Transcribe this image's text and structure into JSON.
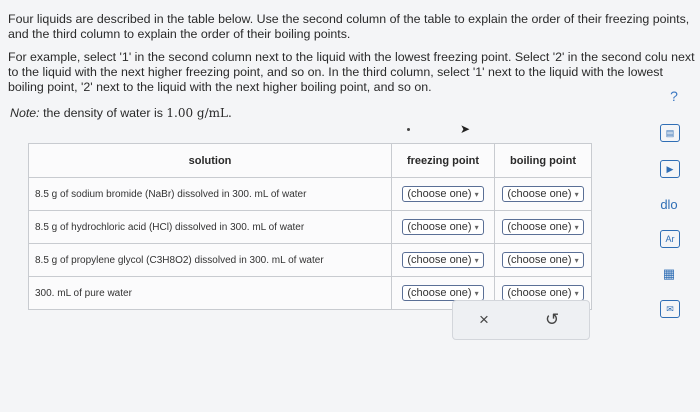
{
  "intro": {
    "p1": "Four liquids are described in the table below. Use the second column of the table to explain the order of their freezing points, and the third column to explain the order of their boiling points.",
    "p2": "For example, select '1' in the second column next to the liquid with the lowest freezing point. Select '2' in the second colu next to the liquid with the next higher freezing point, and so on. In the third column, select '1' next to the liquid with the lowest boiling point, '2' next to the liquid with the next higher boiling point, and so on."
  },
  "note": {
    "label": "Note:",
    "text": "the density of water is",
    "value": "1.00 g/mL."
  },
  "help": {
    "icon": "help-icon",
    "glyph": "?"
  },
  "table": {
    "headers": {
      "solution": "solution",
      "freezing": "freezing point",
      "boiling": "boiling point"
    },
    "rows": [
      {
        "solution": "8.5 g of sodium bromide (NaBr) dissolved in 300. mL of water",
        "freezing": "(choose one)",
        "boiling": "(choose one)"
      },
      {
        "solution": "8.5 g of hydrochloric acid (HCl) dissolved in 300. mL of water",
        "freezing": "(choose one)",
        "boiling": "(choose one)"
      },
      {
        "solution": "8.5 g of propylene glycol (C3H8O2) dissolved in 300. mL of water",
        "freezing": "(choose one)",
        "boiling": "(choose one)"
      },
      {
        "solution": "300. mL of pure water",
        "freezing": "(choose one)",
        "boiling": "(choose one)"
      }
    ]
  },
  "actions": {
    "clear": "×",
    "undo": "↺"
  },
  "tools": [
    "calculator-icon",
    "video-icon",
    "chart-icon",
    "periodic-table-icon",
    "data-table-icon",
    "mail-icon"
  ],
  "tool_glyphs": {
    "video": "▶",
    "chart": "dlo",
    "periodic": "Ar",
    "data": "▦",
    "mail": "✉"
  }
}
